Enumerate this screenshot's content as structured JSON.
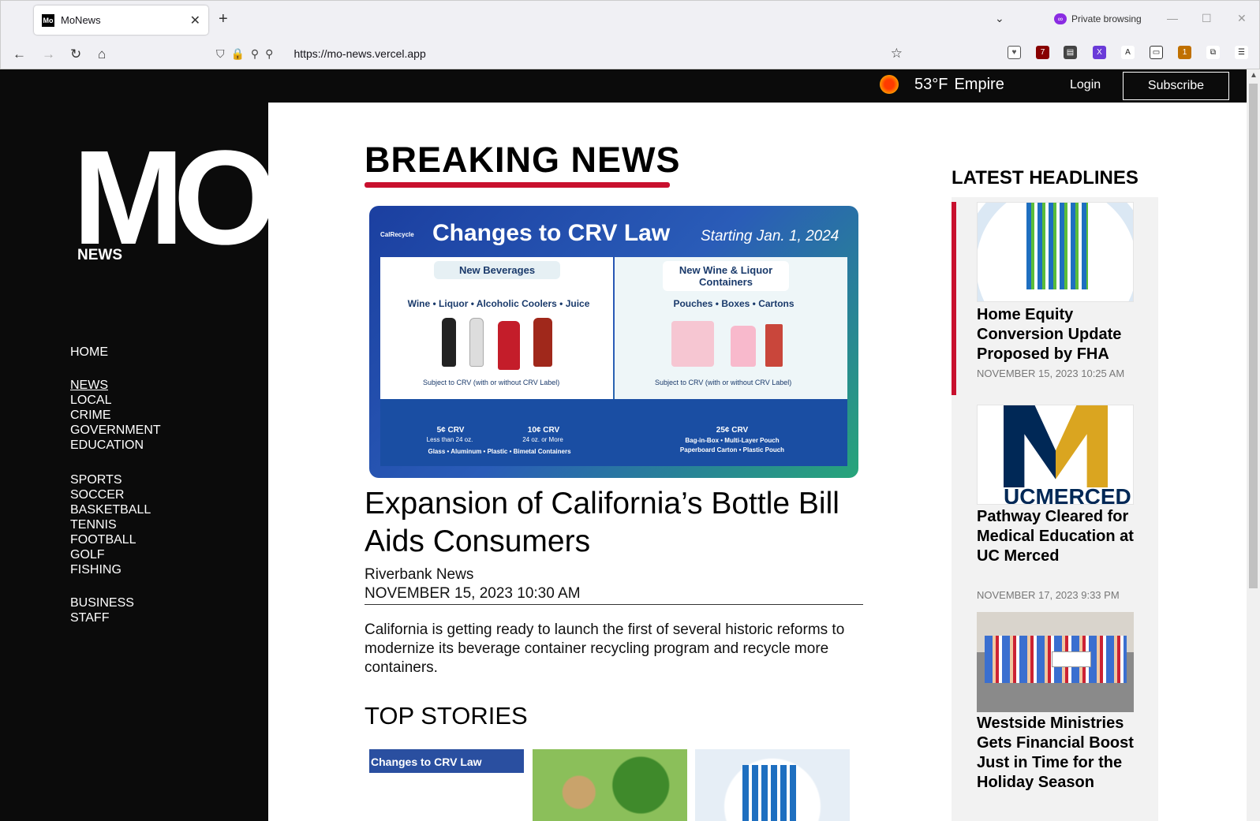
{
  "browser": {
    "tab_title": "MoNews",
    "private_label": "Private browsing",
    "url": "https://mo-news.vercel.app",
    "ext_badges": {
      "ublock": "7",
      "pocket_new": "1"
    }
  },
  "topbar": {
    "temperature": "53°F",
    "location": "Empire",
    "login_label": "Login",
    "subscribe_label": "Subscribe"
  },
  "logo": {
    "mark": "MO",
    "subtitle": "NEWS"
  },
  "nav": {
    "group1": [
      "HOME"
    ],
    "group2": [
      "NEWS",
      "LOCAL",
      "CRIME",
      "GOVERNMENT",
      "EDUCATION"
    ],
    "group3": [
      "SPORTS",
      "SOCCER",
      "BASKETBALL",
      "TENNIS",
      "FOOTBALL",
      "GOLF",
      "FISHING"
    ],
    "group4": [
      "BUSINESS",
      "STAFF"
    ]
  },
  "breaking": {
    "heading": "BREAKING NEWS",
    "image": {
      "brand": "CalRecycle",
      "title": "Changes to CRV Law",
      "starting": "Starting Jan. 1, 2024",
      "left_tab": "New Beverages",
      "left_sub": "Wine • Liquor • Alcoholic Coolers • Juice",
      "left_note": "Subject to CRV (with or without CRV Label)",
      "right_tab": "New Wine & Liquor Containers",
      "right_sub": "Pouches • Boxes • Cartons",
      "right_note": "Subject to CRV (with or without CRV Label)",
      "crv5": "5¢ CRV",
      "crv5_note": "Less than 24 oz.",
      "crv10": "10¢ CRV",
      "crv10_note": "24 oz. or More",
      "crv_left_bottom": "Glass • Aluminum • Plastic • Bimetal Containers",
      "crv25": "25¢ CRV",
      "crv25_note1": "Bag-in-Box • Multi-Layer Pouch",
      "crv25_note2": "Paperboard Carton • Plastic Pouch"
    },
    "headline": "Expansion of California’s Bottle Bill Aids Consumers",
    "source": "Riverbank News",
    "date": "NOVEMBER 15, 2023 10:30 AM",
    "summary": "California is getting ready to launch the first of several historic reforms to modernize its beverage container recycling program and recycle more containers."
  },
  "top_stories": {
    "heading": "TOP STORIES",
    "thumb1_caption": "Changes to CRV Law"
  },
  "latest": {
    "heading": "LATEST HEADLINES",
    "items": [
      {
        "title": "Home Equity Conversion Update Proposed by FHA",
        "date": "NOVEMBER 15, 2023 10:25 AM"
      },
      {
        "title": "Pathway Cleared for Medical Education at UC Merced",
        "date": "NOVEMBER 17, 2023 9:33 PM"
      },
      {
        "title": "Westside Ministries Gets Financial Boost Just in Time for the Holiday Season",
        "date": ""
      }
    ],
    "ucm_text": "UCMERCED"
  },
  "colors": {
    "accent_red": "#c8102e",
    "sidebar_bg": "#0b0b0b"
  }
}
